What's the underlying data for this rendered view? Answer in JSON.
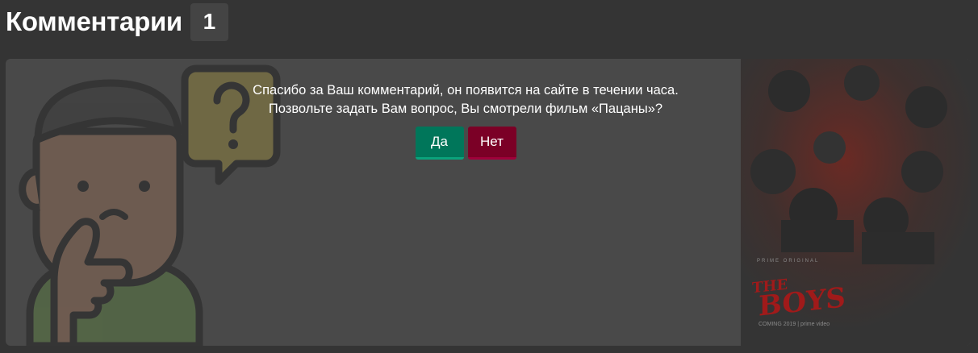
{
  "header": {
    "title": "Комментарии",
    "count": "1"
  },
  "question": {
    "line1": "Спасибо за Ваш комментарий, он появится на сайте в течении часа.",
    "line2": "Позвольте задать Вам вопрос, Вы смотрели фильм «Пацаны»?",
    "yes_label": "Да",
    "no_label": "Нет"
  },
  "poster": {
    "top_text": "PRIME ORIGINAL",
    "title_line1": "THE",
    "title_line2": "BOYS",
    "bottom_text": "COMING 2019 | prime video"
  },
  "colors": {
    "background": "#343434",
    "card": "#494949",
    "yes_button": "#00765a",
    "no_button": "#7b0026",
    "poster_title": "#b01818"
  },
  "icons": {
    "illustration": "thinking-person-question-icon"
  }
}
